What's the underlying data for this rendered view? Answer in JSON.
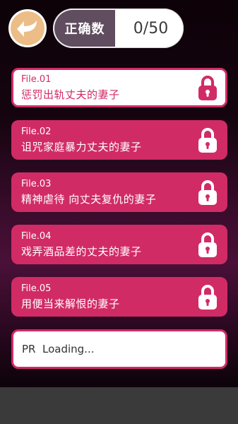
{
  "header": {
    "back_icon": "back-arrow-icon",
    "score_label": "正确数",
    "score_value": "0/50"
  },
  "files": [
    {
      "num": "File.01",
      "title": "惩罚出轨丈夫的妻子",
      "locked": true,
      "selected": true
    },
    {
      "num": "File.02",
      "title": "诅咒家庭暴力丈夫的妻子",
      "locked": true,
      "selected": false
    },
    {
      "num": "File.03",
      "title": "精神虐待 向丈夫复仇的妻子",
      "locked": true,
      "selected": false
    },
    {
      "num": "File.04",
      "title": "戏弄酒品差的丈夫的妻子",
      "locked": true,
      "selected": false
    },
    {
      "num": "File.05",
      "title": "用便当来解恨的妻子",
      "locked": true,
      "selected": false
    }
  ],
  "loading": {
    "text": "PR  Loading..."
  },
  "colors": {
    "accent": "#d12b66",
    "score_dark": "#614d60",
    "back_button": "#ecbd86"
  }
}
